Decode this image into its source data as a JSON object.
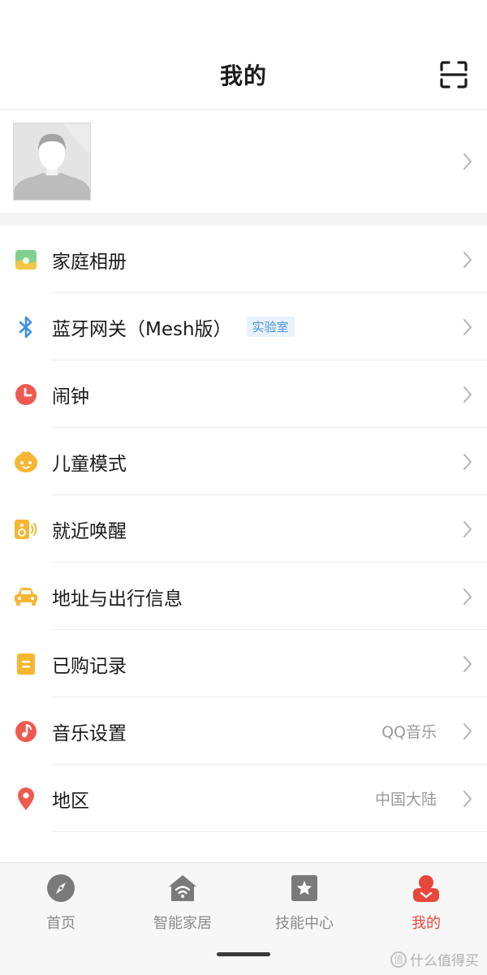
{
  "header": {
    "title": "我的",
    "scan_icon": "scan-icon"
  },
  "profile": {
    "avatar_icon": "default-avatar"
  },
  "menu": [
    {
      "id": "family-album",
      "label": "家庭相册",
      "icon": "album-icon",
      "color": "#5ab76b"
    },
    {
      "id": "bluetooth-gateway",
      "label": "蓝牙网关（Mesh版）",
      "badge": "实验室",
      "icon": "bluetooth-icon",
      "color": "#3e8fe0"
    },
    {
      "id": "alarm",
      "label": "闹钟",
      "icon": "alarm-clock-icon",
      "color": "#ee5a4f"
    },
    {
      "id": "kids-mode",
      "label": "儿童模式",
      "icon": "kid-face-icon",
      "color": "#f6b632"
    },
    {
      "id": "nearby-wake",
      "label": "就近唤醒",
      "icon": "speaker-icon",
      "color": "#f6b632"
    },
    {
      "id": "address-travel",
      "label": "地址与出行信息",
      "icon": "car-icon",
      "color": "#f6b632"
    },
    {
      "id": "purchases",
      "label": "已购记录",
      "icon": "record-icon",
      "color": "#f6b632"
    },
    {
      "id": "music-settings",
      "label": "音乐设置",
      "value": "QQ音乐",
      "icon": "music-note-icon",
      "color": "#ee5a4f"
    },
    {
      "id": "region",
      "label": "地区",
      "value": "中国大陆",
      "icon": "location-pin-icon",
      "color": "#ee5a4f"
    }
  ],
  "tabbar": {
    "items": [
      {
        "id": "home",
        "label": "首页",
        "icon": "compass-icon"
      },
      {
        "id": "smart-home",
        "label": "智能家居",
        "icon": "wifi-house-icon"
      },
      {
        "id": "skills",
        "label": "技能中心",
        "icon": "star-box-icon"
      },
      {
        "id": "mine",
        "label": "我的",
        "icon": "user-icon",
        "active": true
      }
    ]
  },
  "watermark": {
    "text": "什么值得买",
    "logo_glyph": "值"
  },
  "colors": {
    "accent": "#e8473b",
    "badge_text": "#4b93d9",
    "badge_bg": "#e8f2fd",
    "section_gap": "#f4f4f4"
  }
}
